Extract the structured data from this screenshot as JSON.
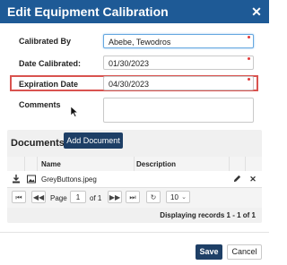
{
  "dialog": {
    "title": "Edit Equipment Calibration",
    "close_icon": "close-icon"
  },
  "form": {
    "calibrated_by": {
      "label": "Calibrated By",
      "value": "Abebe, Tewodros",
      "required": true
    },
    "date_calibrated": {
      "label": "Date Calibrated:",
      "value": "01/30/2023",
      "required": true
    },
    "expiration_date": {
      "label": "Expiration Date",
      "value": "04/30/2023",
      "required": true
    },
    "comments": {
      "label": "Comments",
      "value": ""
    }
  },
  "documents": {
    "title": "Documents",
    "add_label": "Add Document",
    "columns": [
      "Name",
      "Description"
    ],
    "rows": [
      {
        "name": "GreyButtons.jpeg",
        "description": "",
        "download_icon": "download-icon",
        "image_icon": "image-icon",
        "edit_icon": "pencil-icon",
        "delete_icon": "delete-icon"
      }
    ],
    "pager": {
      "page_label": "Page",
      "page_value": "1",
      "of_label": "of 1",
      "page_size": "10",
      "records_text": "Displaying records 1 - 1 of 1"
    }
  },
  "footer": {
    "save_label": "Save",
    "cancel_label": "Cancel"
  },
  "colors": {
    "title_bar": "#1e5a96",
    "primary_button": "#1e3f66",
    "highlight": "#d9534f",
    "required_marker": "#e23a3a"
  }
}
